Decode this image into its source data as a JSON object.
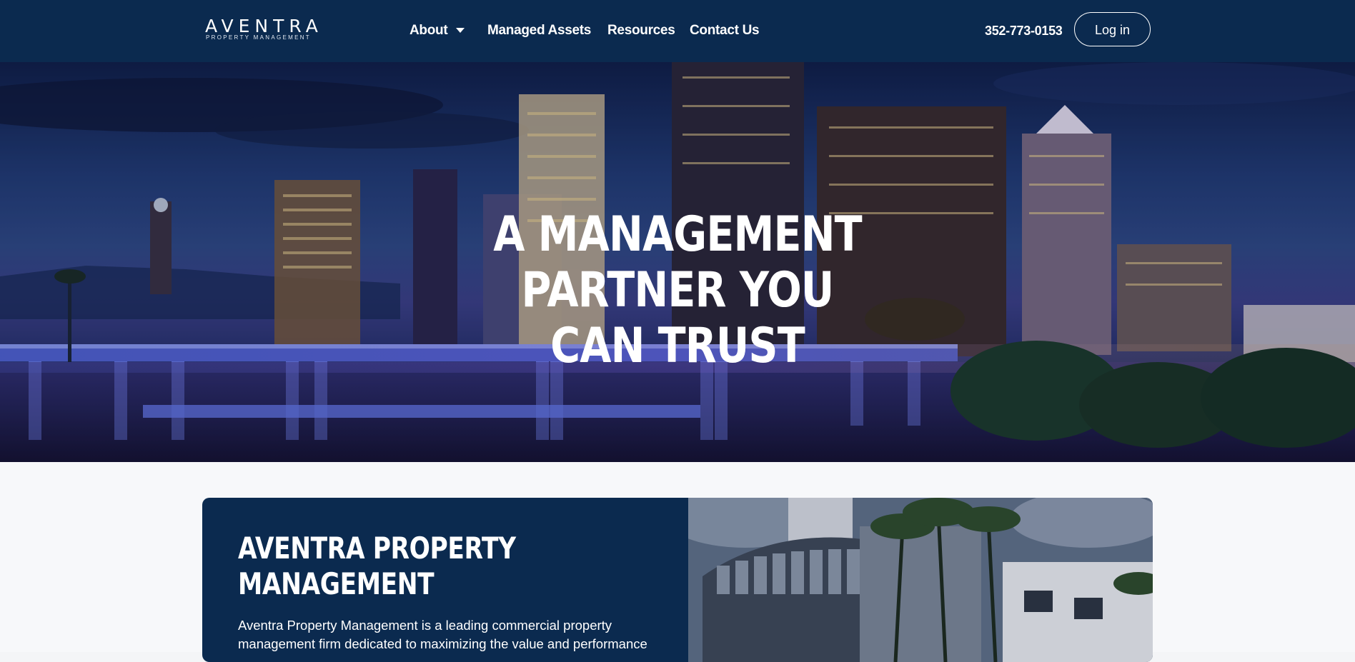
{
  "header": {
    "logo_text": "AVENTRA",
    "logo_subtext": "PROPERTY MANAGEMENT",
    "nav": [
      {
        "label": "About"
      },
      {
        "label": "Managed Assets"
      },
      {
        "label": "Resources"
      },
      {
        "label": "Contact Us"
      }
    ],
    "phone": "352-773-0153",
    "login_label": "Log in"
  },
  "hero": {
    "title_line1": "A MANAGEMENT PARTNER YOU",
    "title_line2": "CAN TRUST"
  },
  "about": {
    "title_line1": "AVENTRA PROPERTY",
    "title_line2": "MANAGEMENT",
    "text": "Aventra Property Management is a leading commercial property management firm dedicated to maximizing the value and performance"
  },
  "colors": {
    "navy": "#0b2a4f",
    "white": "#ffffff"
  },
  "icons": {
    "about_dropdown": "chevron-down-icon"
  }
}
